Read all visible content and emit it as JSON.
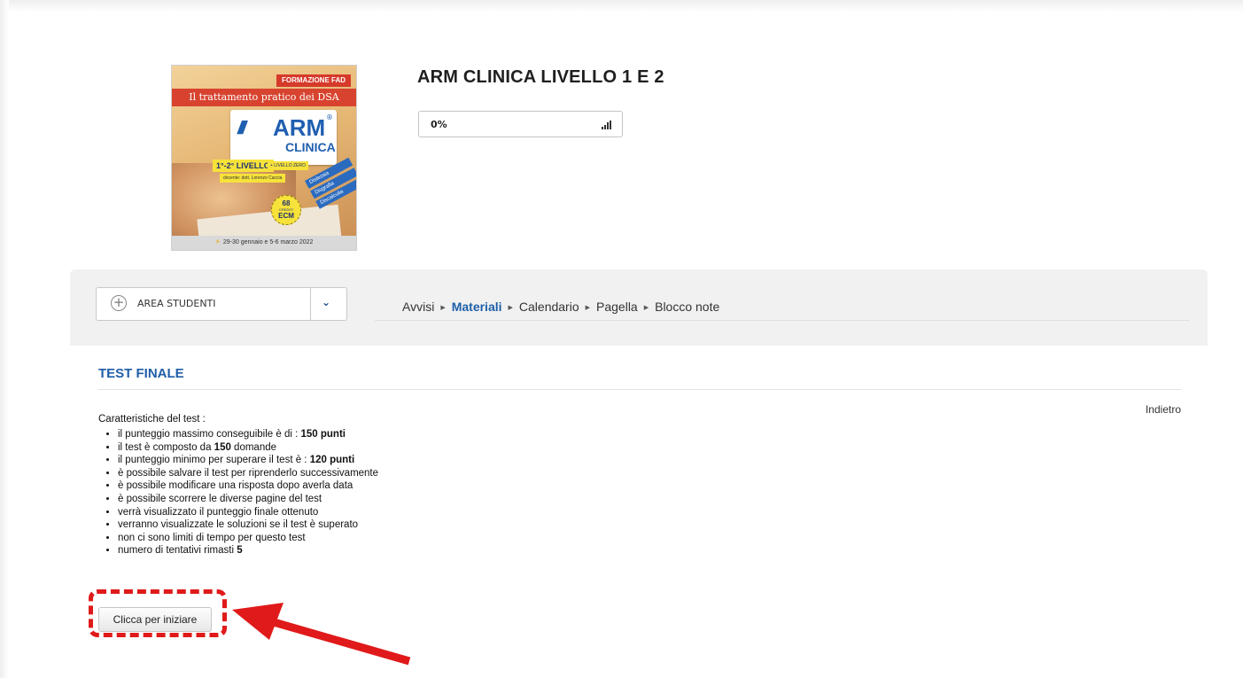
{
  "course": {
    "title": "ARM CLINICA LIVELLO 1 E 2",
    "progress_label": "0%",
    "progress_icon": "signal-bars-icon"
  },
  "cover": {
    "badge": "FORMAZIONE FAD",
    "headline": "Il trattamento pratico dei DSA",
    "logo_text": "ARM",
    "logo_registered": "®",
    "logo_sub": "CLINICA",
    "level": "1°-2° LIVELLO",
    "level_extra": "+ LIVELLO ZERO",
    "teacher": "docente: dott. Lorenzo Caccia",
    "tags": [
      "Dislessia",
      "Disgrafia",
      "Discalculia"
    ],
    "ecm_number": "68",
    "ecm_caption": "CREDITI",
    "ecm_label": "ECM",
    "dates": "29-30 gennaio e 5-6 marzo 2022"
  },
  "nav": {
    "dropdown_label": "AREA STUDENTI",
    "breadcrumb": [
      {
        "label": "Avvisi",
        "active": false
      },
      {
        "label": "Materiali",
        "active": true
      },
      {
        "label": "Calendario",
        "active": false
      },
      {
        "label": "Pagella",
        "active": false
      },
      {
        "label": "Blocco note",
        "active": false
      }
    ]
  },
  "section": {
    "title": "TEST FINALE",
    "back_label": "Indietro"
  },
  "test": {
    "intro": "Caratteristiche del test :",
    "features": [
      {
        "text": "il punteggio massimo conseguibile è di : ",
        "bold": "150 punti",
        "after": ""
      },
      {
        "text": "il test è composto da ",
        "bold": "150",
        "after": " domande"
      },
      {
        "text": "il punteggio minimo per superare il test è : ",
        "bold": "120 punti",
        "after": ""
      },
      {
        "text": "è possibile salvare il test per riprenderlo successivamente",
        "bold": "",
        "after": ""
      },
      {
        "text": "è possibile modificare una risposta dopo averla data",
        "bold": "",
        "after": ""
      },
      {
        "text": "è possibile scorrere le diverse pagine del test",
        "bold": "",
        "after": ""
      },
      {
        "text": "verrà visualizzato il punteggio finale ottenuto",
        "bold": "",
        "after": ""
      },
      {
        "text": "verranno visualizzate le soluzioni se il test è superato",
        "bold": "",
        "after": ""
      },
      {
        "text": "non ci sono limiti di tempo per questo test",
        "bold": "",
        "after": ""
      },
      {
        "text": "numero di tentativi rimasti ",
        "bold": "5",
        "after": ""
      }
    ],
    "start_label": "Clicca per iniziare"
  },
  "colors": {
    "accent": "#1f5ea8",
    "annotation": "#e01a1a"
  }
}
